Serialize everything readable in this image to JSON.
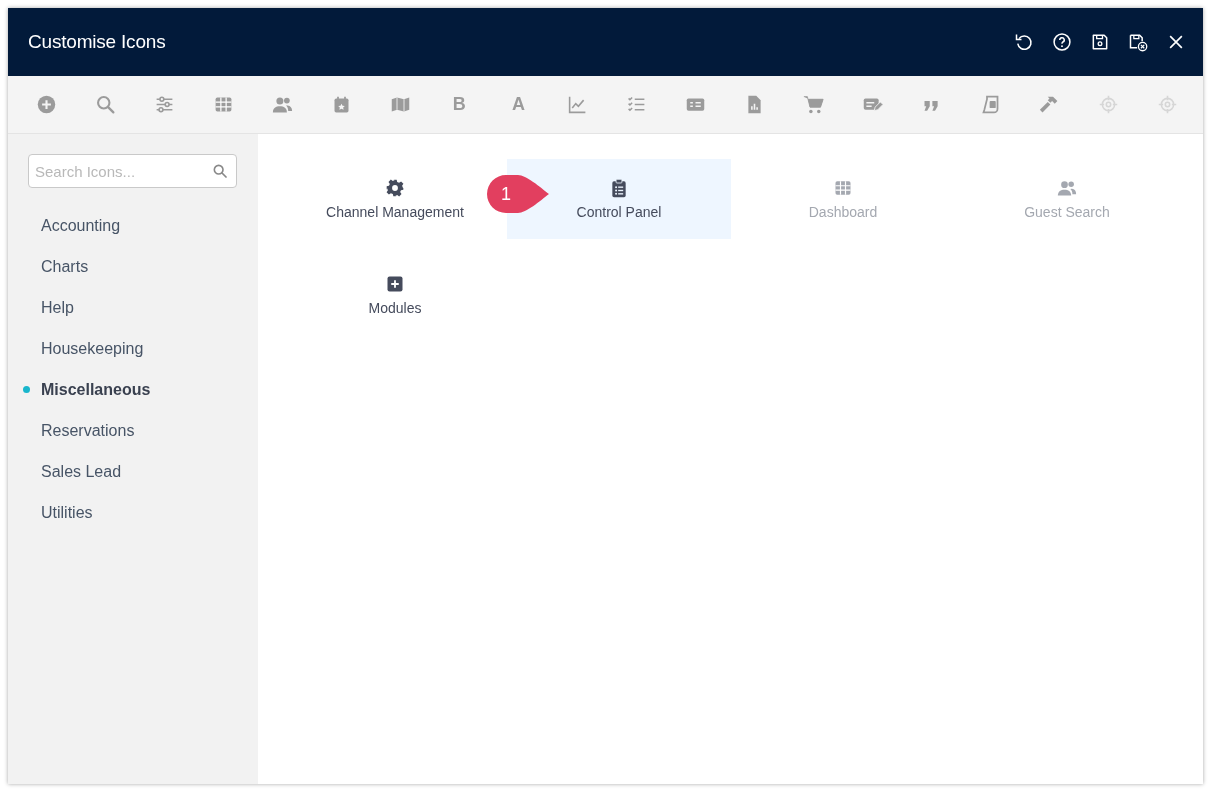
{
  "window": {
    "title": "Customise Icons"
  },
  "header_buttons": [
    {
      "kind": "undo"
    },
    {
      "kind": "help"
    },
    {
      "kind": "save"
    },
    {
      "kind": "save-cancel"
    },
    {
      "kind": "close"
    }
  ],
  "toolbar": [
    {
      "kind": "plus-circle",
      "disabled": false
    },
    {
      "kind": "search",
      "disabled": false
    },
    {
      "kind": "sliders",
      "disabled": false
    },
    {
      "kind": "grid",
      "disabled": false
    },
    {
      "kind": "users",
      "disabled": false
    },
    {
      "kind": "calendar",
      "disabled": false
    },
    {
      "kind": "map",
      "disabled": false
    },
    {
      "kind": "letter",
      "label": "B",
      "disabled": false
    },
    {
      "kind": "letter",
      "label": "A",
      "disabled": false
    },
    {
      "kind": "line-chart",
      "disabled": false
    },
    {
      "kind": "checklist",
      "disabled": false
    },
    {
      "kind": "money",
      "disabled": false
    },
    {
      "kind": "file-chart",
      "disabled": false
    },
    {
      "kind": "cart",
      "disabled": false
    },
    {
      "kind": "edit-card",
      "disabled": false
    },
    {
      "kind": "quote",
      "disabled": false
    },
    {
      "kind": "scroll",
      "disabled": false
    },
    {
      "kind": "hammer",
      "disabled": false
    },
    {
      "kind": "crosshair",
      "disabled": true
    },
    {
      "kind": "crosshair",
      "disabled": true
    }
  ],
  "search": {
    "placeholder": "Search Icons..."
  },
  "categories": [
    {
      "label": "Accounting",
      "selected": false
    },
    {
      "label": "Charts",
      "selected": false
    },
    {
      "label": "Help",
      "selected": false
    },
    {
      "label": "Housekeeping",
      "selected": false
    },
    {
      "label": "Miscellaneous",
      "selected": true
    },
    {
      "label": "Reservations",
      "selected": false
    },
    {
      "label": "Sales Lead",
      "selected": false
    },
    {
      "label": "Utilities",
      "selected": false
    }
  ],
  "icons": [
    {
      "label": "Channel Management",
      "kind": "gear",
      "selected": false,
      "disabled": false
    },
    {
      "label": "Control Panel",
      "kind": "clipboard",
      "selected": true,
      "disabled": false
    },
    {
      "label": "Dashboard",
      "kind": "grid",
      "selected": false,
      "disabled": true
    },
    {
      "label": "Guest Search",
      "kind": "users",
      "selected": false,
      "disabled": true
    },
    {
      "label": "Modules",
      "kind": "plus-square",
      "selected": false,
      "disabled": false
    }
  ],
  "callout": {
    "label": "1"
  }
}
